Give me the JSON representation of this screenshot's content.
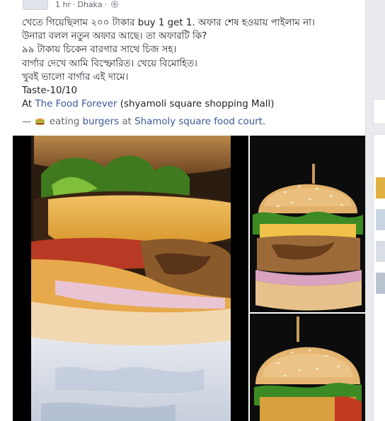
{
  "post": {
    "time": "1 hr",
    "separator": "·",
    "location": "Dhaka",
    "separator2": "·",
    "privacy_icon": "globe-icon",
    "lines": [
      "খেতে গিয়েছিলাম ২০০ টাকার buy 1 get 1. অফার শেষ হওয়ায় পাইলাম না।",
      "উনারা বলল নতুন অফার আছে। তা অফারটি কি?",
      "৯৯ টাকায় চিকেন বারগার সাথে চিজ সহ।",
      "বার্গার দেখে আমি বিস্ফোরিত। খেয়ে বিমোহিত।",
      "খুবই ভালো বার্গার এই দামে।",
      "Taste-10/10"
    ],
    "at_prefix": "At",
    "place_link": "The Food Forever",
    "place_suffix": "(shyamoli square shopping Mall)",
    "activity_dash": "—",
    "activity_icon": "burger-emoji-icon",
    "activity_verb": "eating",
    "activity_object": "burgers",
    "activity_at": "at",
    "activity_place": "Shamoly square food court."
  },
  "colors": {
    "link": "#385898",
    "meta": "#616770",
    "text": "#1d2129",
    "background": "#e9ebee"
  }
}
